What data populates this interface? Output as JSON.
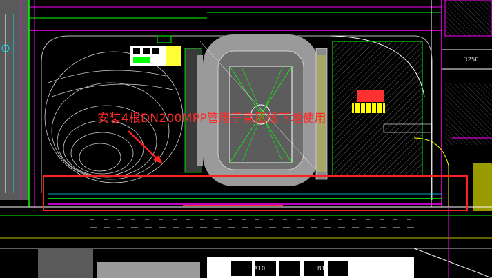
{
  "annotation": "安装4根DN200MPP管用于高压线下地使用",
  "labels": {
    "dim_right": "3250",
    "block_a": "A10",
    "block_b": "B10"
  },
  "colors": {
    "background": "#000000",
    "annotation": "#ff2a2a",
    "highlight_box": "#ff2020",
    "magenta": "#ff00ff",
    "green": "#00ff00",
    "cyan": "#00ffff",
    "yellow": "#ffff00",
    "white": "#ffffff",
    "track_gray": "#9a9a9a"
  }
}
